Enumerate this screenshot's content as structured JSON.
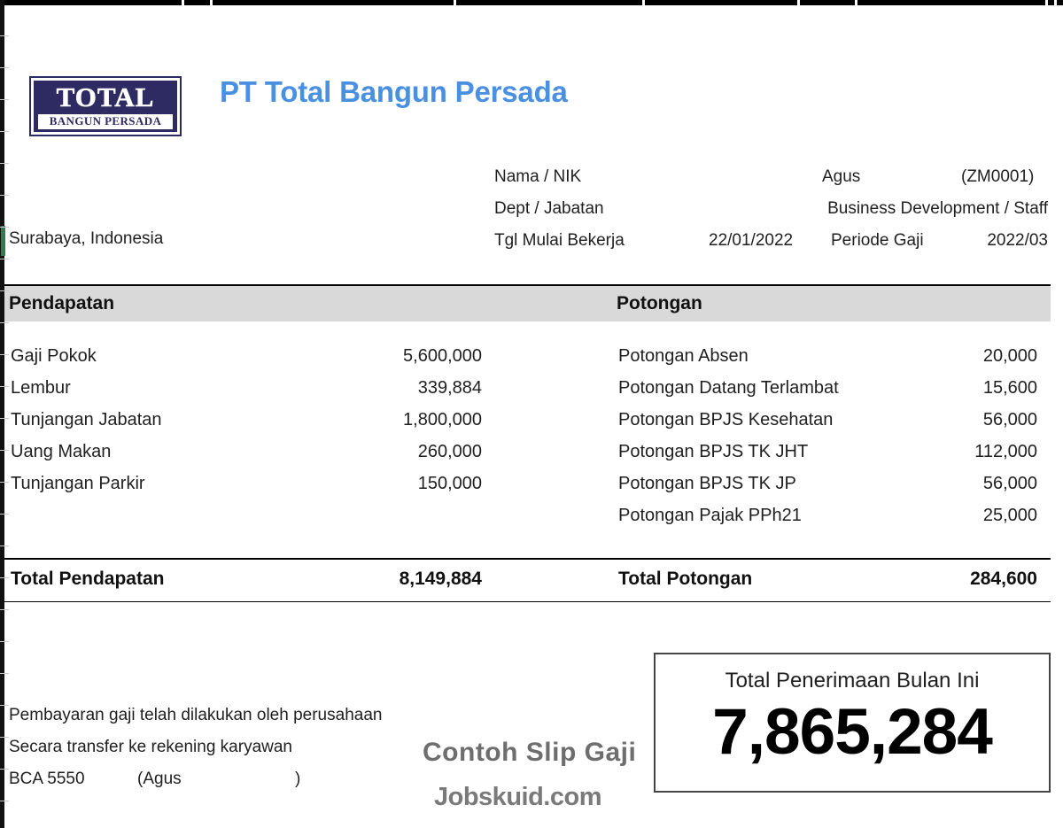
{
  "document": {
    "kind": "slip-gaji",
    "company_name": "PT Total Bangun Persada",
    "company_city": "Surabaya, Indonesia",
    "title_color": "#4a90e2"
  },
  "logo": {
    "main_text": "TOTAL",
    "sub_text": "BANGUN PERSADA",
    "background": "#2e2b63",
    "text_color": "#ffffff"
  },
  "employee": {
    "nama_label": "Nama / NIK",
    "nama_value": "Agus",
    "nik_value": "(ZM0001)",
    "dept_label": "Dept / Jabatan",
    "dept_value": "Business Development / Staff",
    "tgl_label": "Tgl Mulai Bekerja",
    "tgl_value": "22/01/2022",
    "periode_label": "Periode Gaji",
    "periode_value": "2022/03"
  },
  "sections": {
    "earnings_header": "Pendapatan",
    "deductions_header": "Potongan",
    "band_color": "#d9d9d9"
  },
  "earnings": {
    "items": [
      {
        "name": "Gaji Pokok",
        "amount": "5,600,000"
      },
      {
        "name": "Lembur",
        "amount": "339,884"
      },
      {
        "name": "Tunjangan Jabatan",
        "amount": "1,800,000"
      },
      {
        "name": "Uang Makan",
        "amount": "260,000"
      },
      {
        "name": "Tunjangan Parkir",
        "amount": "150,000"
      }
    ],
    "total_label": "Total Pendapatan",
    "total_amount": "8,149,884"
  },
  "deductions": {
    "items": [
      {
        "name": "Potongan Absen",
        "amount": "20,000"
      },
      {
        "name": "Potongan Datang Terlambat",
        "amount": "15,600"
      },
      {
        "name": "Potongan BPJS Kesehatan",
        "amount": "56,000"
      },
      {
        "name": "Potongan BPJS TK JHT",
        "amount": "112,000"
      },
      {
        "name": "Potongan BPJS TK JP",
        "amount": "56,000"
      },
      {
        "name": "Potongan Pajak PPh21",
        "amount": "25,000"
      }
    ],
    "total_label": "Total Potongan",
    "total_amount": "284,600"
  },
  "net_pay": {
    "label": "Total Penerimaan Bulan Ini",
    "amount": "7,865,284"
  },
  "footer": {
    "note_line_1": "Pembayaran gaji telah dilakukan oleh perusahaan",
    "note_line_2": "Secara transfer ke rekening karyawan",
    "bank_account": "BCA 5550",
    "bank_holder": "(Agus",
    "bank_paren_close": ")"
  },
  "watermarks": {
    "sample_label": "Contoh Slip Gaji",
    "site_label": "Jobskuid.com"
  }
}
